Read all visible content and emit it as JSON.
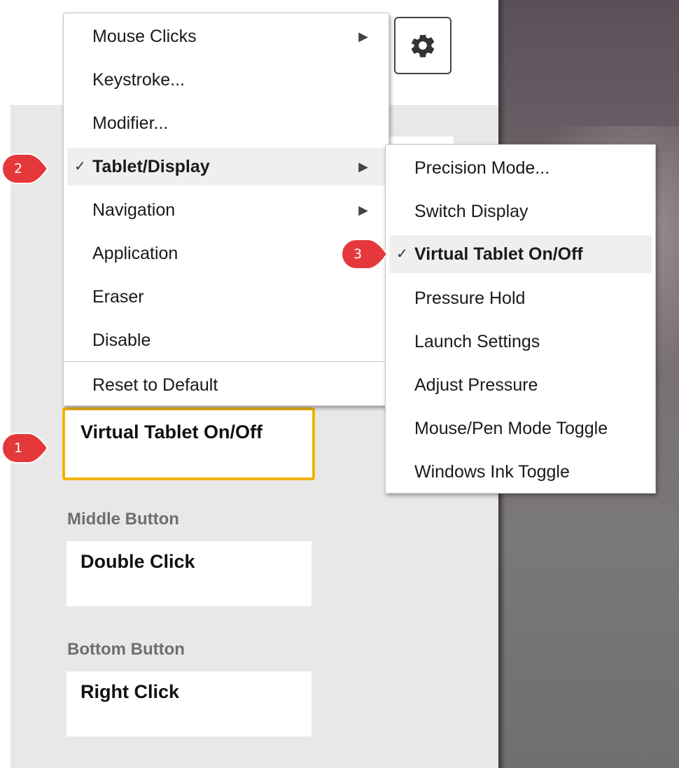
{
  "menu": {
    "items": [
      {
        "label": "Mouse Clicks",
        "submenu": true
      },
      {
        "label": "Keystroke..."
      },
      {
        "label": "Modifier..."
      },
      {
        "label": "Tablet/Display",
        "submenu": true,
        "checked": true
      },
      {
        "label": "Navigation",
        "submenu": true
      },
      {
        "label": "Application"
      },
      {
        "label": "Eraser"
      },
      {
        "label": "Disable"
      }
    ],
    "reset_label": "Reset to Default"
  },
  "submenu": {
    "items": [
      {
        "label": "Precision Mode..."
      },
      {
        "label": "Switch Display"
      },
      {
        "label": "Virtual Tablet On/Off",
        "checked": true
      },
      {
        "label": "Pressure Hold"
      },
      {
        "label": "Launch Settings"
      },
      {
        "label": "Adjust Pressure"
      },
      {
        "label": "Mouse/Pen Mode Toggle"
      },
      {
        "label": "Windows Ink Toggle"
      }
    ]
  },
  "buttons": {
    "top_value": "Virtual Tablet On/Off",
    "middle_label": "Middle Button",
    "middle_value": "Double Click",
    "bottom_label": "Bottom Button",
    "bottom_value": "Right Click"
  },
  "callouts": [
    "1",
    "2",
    "3"
  ],
  "glyphs": {
    "check": "✓",
    "arrow": "▶"
  },
  "colors": {
    "highlight": "#f2b400",
    "callout": "#e5383b",
    "panel": "#e8e8e8"
  },
  "icons": {
    "settings": "gear-icon"
  }
}
